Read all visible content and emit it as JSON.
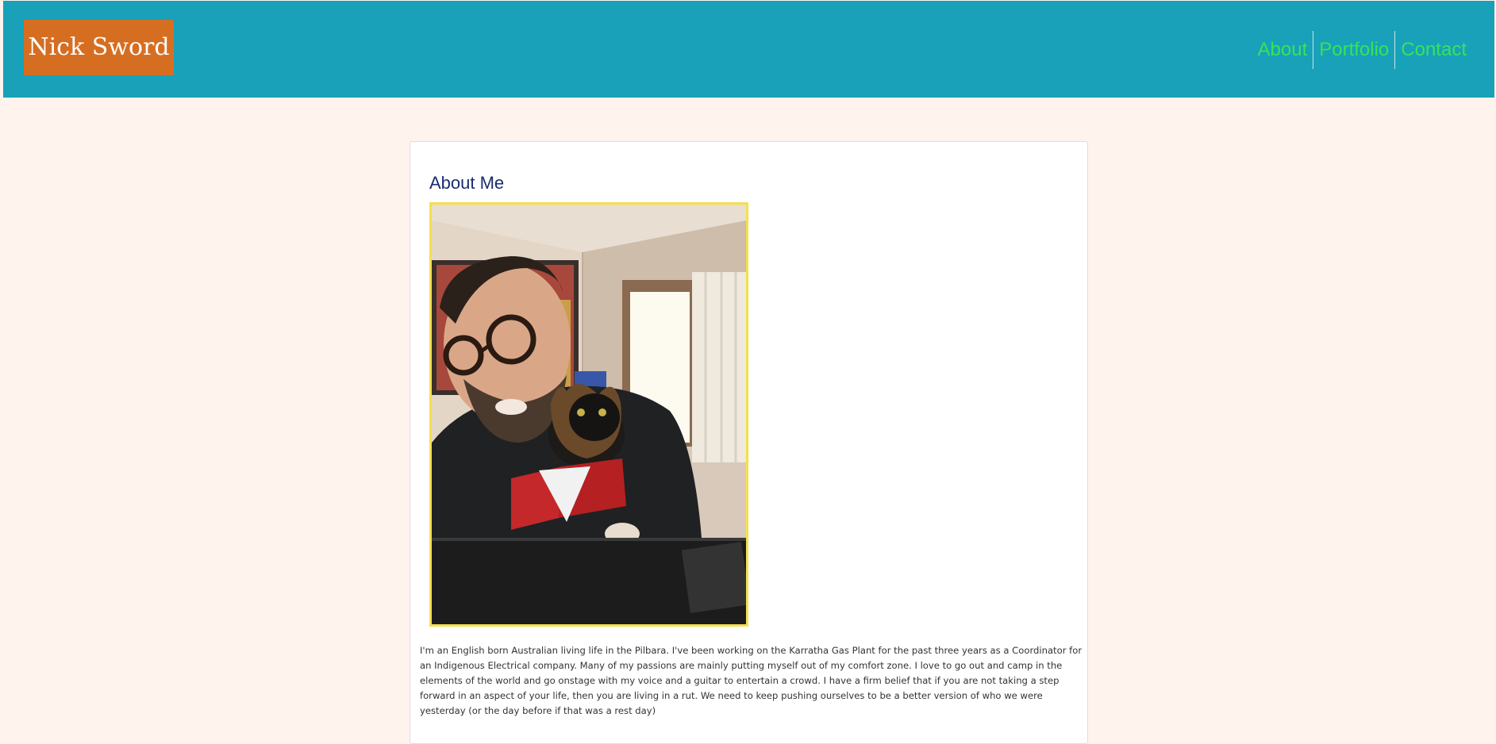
{
  "header": {
    "logo_text": "Nick Sword",
    "nav": [
      {
        "label": "About"
      },
      {
        "label": "Portfolio"
      },
      {
        "label": "Contact"
      }
    ]
  },
  "about": {
    "title": "About Me",
    "bio": "I'm an English born Australian living life in the Pilbara. I've been working on the Karratha Gas Plant for the past three years as a Coordinator for an Indigenous Electrical company. Many of my passions are mainly putting myself out of my comfort zone. I love to go out and camp in the elements of the world and go onstage with my voice and a guitar to entertain a crowd. I have a firm belief that if you are not taking a step forward in an aspect of your life, then you are living in a rut. We need to keep pushing ourselves to be a better version of who we were yesterday (or the day before if that was a rest day)"
  },
  "colors": {
    "header_bg": "#18a1b8",
    "logo_bg": "#d66e22",
    "nav_text": "#36e35a",
    "page_bg": "#fff3ee",
    "title_text": "#1a2c6e",
    "photo_border": "#f4e04d"
  }
}
